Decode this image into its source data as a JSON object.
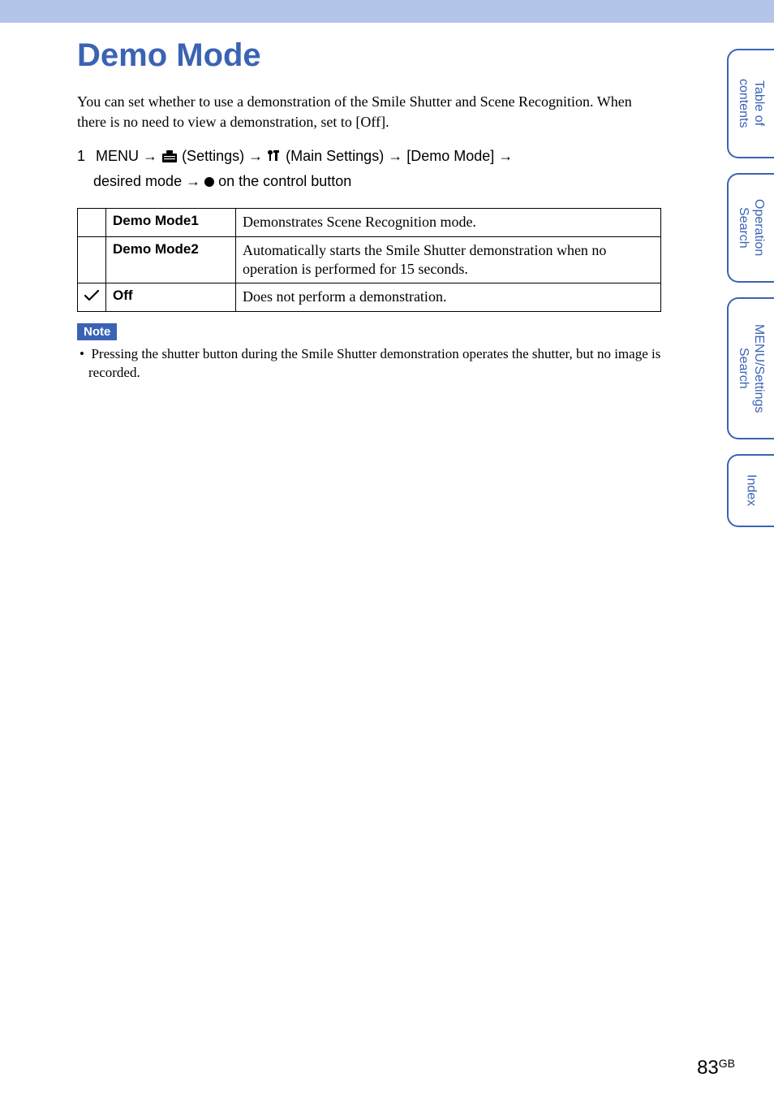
{
  "page": {
    "title": "Demo Mode",
    "intro": "You can set whether to use a demonstration of the Smile Shutter and Scene Recognition. When there is no need to view a demonstration, set to [Off].",
    "step_number": "1",
    "step_prefix": "MENU",
    "step_settings": "(Settings)",
    "step_main_settings": "(Main Settings)",
    "step_demo_mode": "[Demo Mode]",
    "step_desired_mode": "desired mode",
    "step_on_control": "on the control button",
    "note_label": "Note",
    "note_bullet": "•",
    "note_text": "Pressing the shutter button during the Smile Shutter demonstration operates the shutter, but no image is recorded.",
    "page_num": "83",
    "page_suffix": "GB"
  },
  "table": {
    "rows": [
      {
        "checked": false,
        "label": "Demo Mode1",
        "desc": "Demonstrates Scene Recognition mode."
      },
      {
        "checked": false,
        "label": "Demo Mode2",
        "desc": "Automatically starts the Smile Shutter demonstration when no operation is performed for 15 seconds."
      },
      {
        "checked": true,
        "label": "Off",
        "desc": "Does not perform a demonstration."
      }
    ]
  },
  "sidebar": {
    "tabs": [
      "Table of contents",
      "Operation Search",
      "MENU/Settings Search",
      "Index"
    ]
  }
}
